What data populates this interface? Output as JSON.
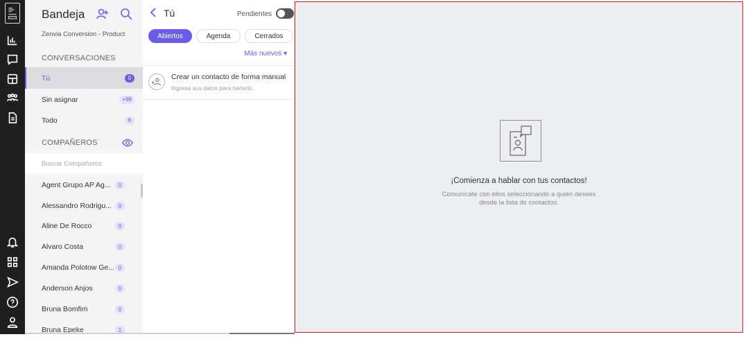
{
  "rail": {
    "icons": [
      "zenvia-logo-icon",
      "chart-icon",
      "chat-icon",
      "grid-table-icon",
      "team-icon",
      "document-icon",
      "bell-icon",
      "apps-icon",
      "send-icon",
      "help-icon",
      "user-icon"
    ]
  },
  "inbox": {
    "title": "Bandeja",
    "subtitle": "Zenvia Conversion - Product",
    "conversations_header": "CONVERSACIONES",
    "items": [
      {
        "label": "Tú",
        "count": "0"
      },
      {
        "label": "Sin asignar",
        "count": "+99"
      },
      {
        "label": "Todo",
        "count": "6"
      }
    ],
    "companions_header": "COMPAÑEROS",
    "search_placeholder": "Buscar Compañeros",
    "agents": [
      {
        "name": "Agent Grupo AP Ag...",
        "count": "0"
      },
      {
        "name": "Alessandro Rodrigu...",
        "count": "0"
      },
      {
        "name": "Aline De Rocco",
        "count": "0"
      },
      {
        "name": "Alvaro Costa",
        "count": "0"
      },
      {
        "name": "Amanda Polotow Ge...",
        "count": "0"
      },
      {
        "name": "Anderson Anjos",
        "count": "0"
      },
      {
        "name": "Bruna Bomfim",
        "count": "0"
      },
      {
        "name": "Bruna Epeke",
        "count": "1"
      }
    ]
  },
  "conversations": {
    "title": "Tú",
    "pending_label": "Pendientes",
    "tabs": [
      "Abiertos",
      "Agenda",
      "Cerrados"
    ],
    "sort_label": "Más nuevos ▾",
    "create_contact_title": "Crear un contacto de forma manual",
    "create_contact_sub": "Ingresa sus datos para hacerlo."
  },
  "main": {
    "empty_title": "¡Comienza a hablar con tus contactos!",
    "empty_sub": "Comunícate con ellos seleccionando a quién desees desde la lista de contactos."
  },
  "colors": {
    "accent": "#6b5ce7",
    "rail": "#1f1f1f",
    "panel": "#eceef1",
    "highlight_border": "#e11d1d"
  }
}
